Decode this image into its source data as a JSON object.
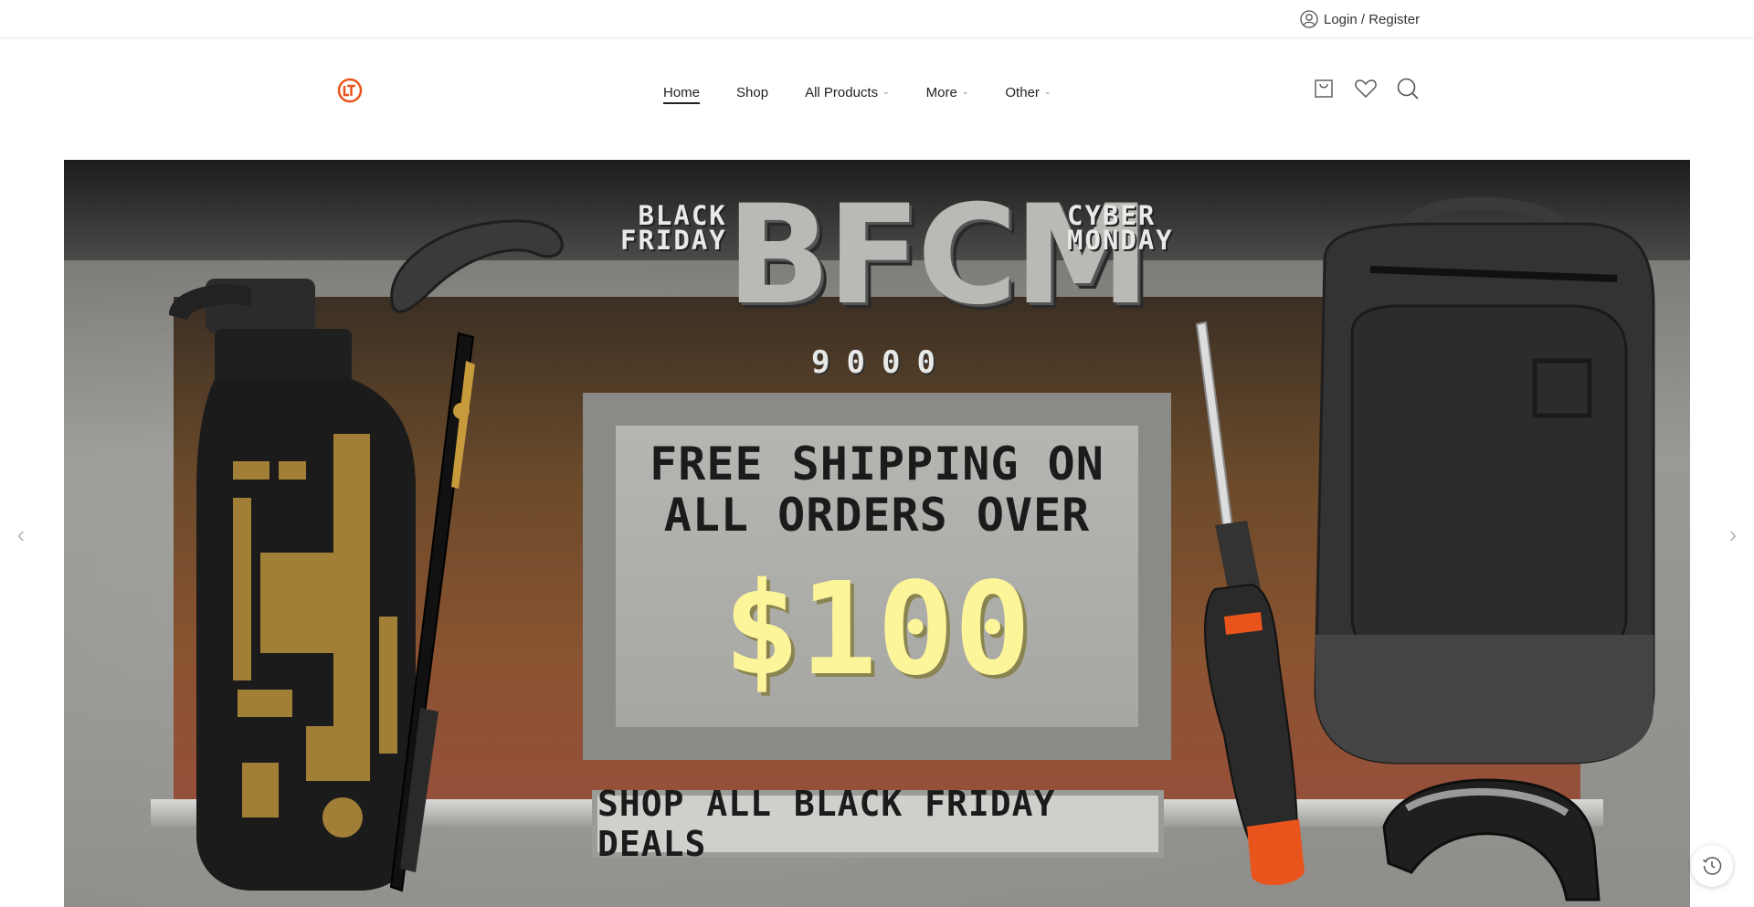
{
  "topbar": {
    "login_label": "Login / Register",
    "login_icon": "user-icon"
  },
  "header": {
    "logo_icon": "brand-logo",
    "nav": [
      {
        "label": "Home",
        "active": true,
        "dropdown": false
      },
      {
        "label": "Shop",
        "active": false,
        "dropdown": false
      },
      {
        "label": "All Products",
        "active": false,
        "dropdown": true
      },
      {
        "label": "More",
        "active": false,
        "dropdown": true
      },
      {
        "label": "Other",
        "active": false,
        "dropdown": true
      }
    ],
    "caret": "⌄",
    "actions": [
      "cart-icon",
      "heart-icon",
      "search-icon"
    ]
  },
  "hero": {
    "left_label_line1": "BLACK",
    "left_label_line2": "FRIDAY",
    "main_title": "BFCM",
    "sub_title": "9000",
    "right_label_line1": "CYBER",
    "right_label_line2": "MONDAY",
    "panel_line1": "FREE SHIPPING ON",
    "panel_line2": "ALL ORDERS OVER",
    "price": "$100",
    "cta_label": "SHOP ALL BLACK FRIDAY DEALS",
    "prev_arrow": "‹",
    "next_arrow": "›"
  },
  "colors": {
    "accent": "#e8541c",
    "price_yellow": "#fdf59a"
  },
  "floating": {
    "history_icon": "history-icon"
  }
}
